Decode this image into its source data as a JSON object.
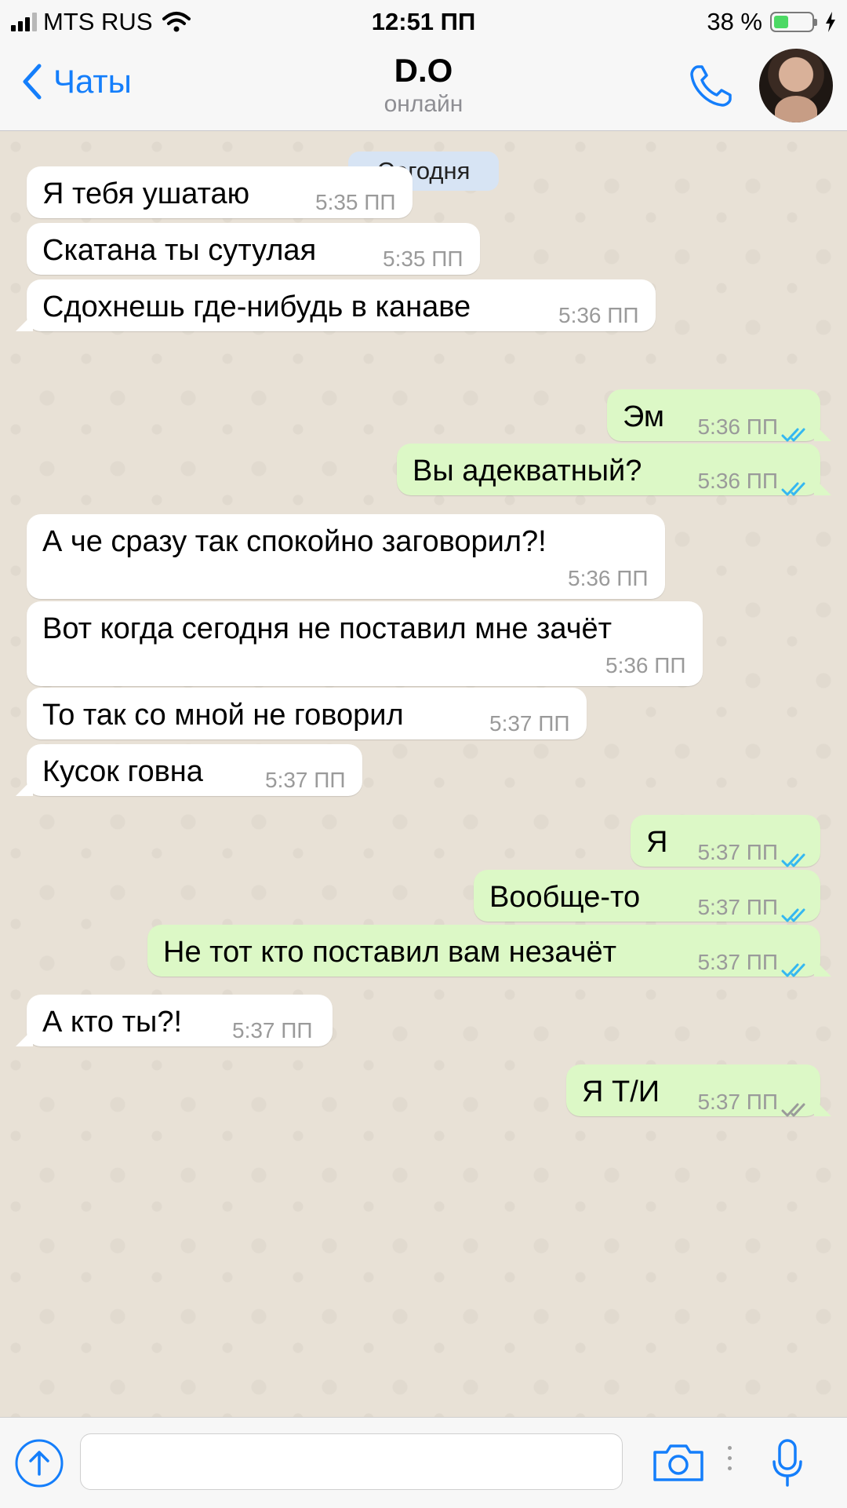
{
  "status_bar": {
    "carrier": "MTS RUS",
    "time": "12:51 ПП",
    "battery_percent": "38 %",
    "battery_level": 0.38
  },
  "header": {
    "back_label": "Чаты",
    "contact_name": "D.O",
    "contact_status": "онлайн"
  },
  "chat": {
    "date_label": "Сегодня",
    "messages": [
      {
        "direction": "in",
        "text": "Я тебя ушатаю",
        "time": "5:35 ПП"
      },
      {
        "direction": "in",
        "text": "Скатана ты сутулая",
        "time": "5:35 ПП"
      },
      {
        "direction": "in",
        "text": "Сдохнешь где-нибудь в канаве",
        "time": "5:36 ПП"
      },
      {
        "direction": "out",
        "text": "Эм",
        "time": "5:36 ПП",
        "status": "read"
      },
      {
        "direction": "out",
        "text": "Вы адекватный?",
        "time": "5:36 ПП",
        "status": "read"
      },
      {
        "direction": "in",
        "text": "А че сразу так спокойно заговорил?!",
        "time": "5:36 ПП"
      },
      {
        "direction": "in",
        "text": "Вот когда сегодня не поставил мне зачёт",
        "time": "5:36 ПП"
      },
      {
        "direction": "in",
        "text": "То так со мной не говорил",
        "time": "5:37 ПП"
      },
      {
        "direction": "in",
        "text": "Кусок говна",
        "time": "5:37 ПП"
      },
      {
        "direction": "out",
        "text": "Я",
        "time": "5:37 ПП",
        "status": "read"
      },
      {
        "direction": "out",
        "text": "Вообще-то",
        "time": "5:37 ПП",
        "status": "read"
      },
      {
        "direction": "out",
        "text": "Не тот кто поставил вам незачёт",
        "time": "5:37 ПП",
        "status": "read"
      },
      {
        "direction": "in",
        "text": "А кто ты?!",
        "time": "5:37 ПП"
      },
      {
        "direction": "out",
        "text": "Я Т/И",
        "time": "5:37 ПП",
        "status": "delivered"
      }
    ]
  },
  "input_bar": {
    "message_placeholder": ""
  },
  "icons": {
    "back": "chevron-left-icon",
    "call": "phone-icon",
    "attach": "arrow-up-circle-icon",
    "camera": "camera-icon",
    "mic": "microphone-icon",
    "read": "double-check-blue-icon",
    "delivered": "double-check-gray-icon"
  },
  "colors": {
    "accent": "#147efb",
    "outgoing_bubble": "#dcf8c6",
    "incoming_bubble": "#ffffff",
    "read_tick": "#34b7f1",
    "delivered_tick": "#9a9a9a",
    "date_badge": "#d7e4f4"
  }
}
